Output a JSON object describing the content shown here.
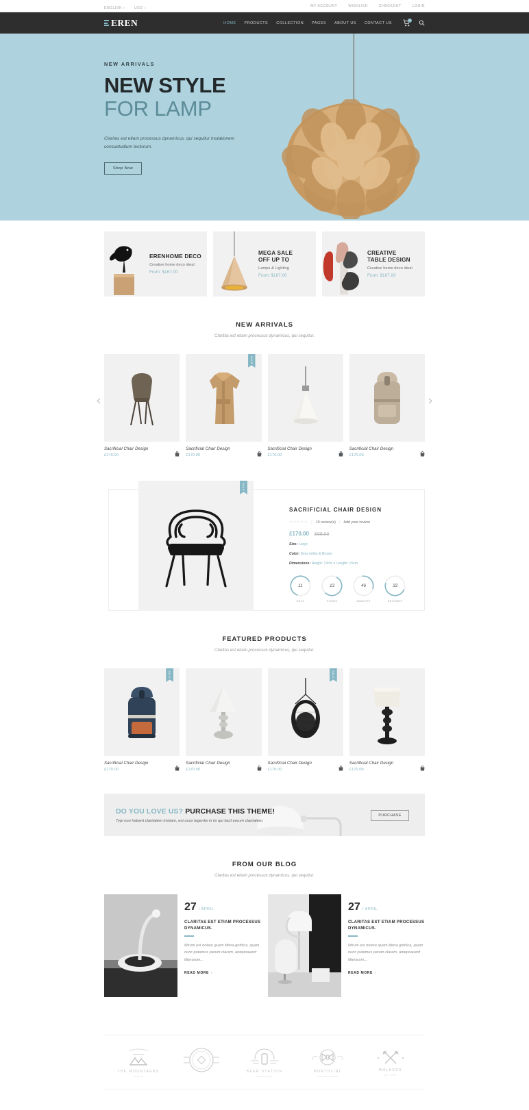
{
  "topbar": {
    "language": "ENGLISH",
    "currency": "USD",
    "links": [
      "MY ACCOUNT",
      "WISHLISH",
      "CHECKOUT",
      "LOGIN"
    ]
  },
  "header": {
    "brand": "EREN",
    "nav": [
      {
        "label": "HOME",
        "active": true
      },
      {
        "label": "PRODUCTS",
        "active": false
      },
      {
        "label": "COLLECTION",
        "active": false
      },
      {
        "label": "PAGES",
        "active": false
      },
      {
        "label": "ABOUT US",
        "active": false
      },
      {
        "label": "CONTACT US",
        "active": false
      }
    ],
    "cart_count": "0",
    "search_icon": "search-icon",
    "cart_icon": "cart-icon"
  },
  "hero": {
    "eyebrow": "NEW ARRIVALS",
    "title_line1": "NEW STYLE",
    "title_line2": "FOR LAMP",
    "paragraph": "Claritas est etiam processus dynamicus, qui sequitur mutationem consuetudium lectorum.",
    "cta": "Shop Now",
    "bg_color": "#aed3de"
  },
  "promos": [
    {
      "title": "ERENHOME DECO",
      "subtitle": "Creative home deco ideal",
      "price": "From: $167.00",
      "art": "bird-statue"
    },
    {
      "title": "MEGA SALE\nOFF UP TO",
      "title_line1": "MEGA SALE",
      "title_line2": "OFF UP TO",
      "subtitle": "Lamps & Lighting",
      "price": "From: $167.00",
      "art": "cone-pendant-lamp"
    },
    {
      "title_line1": "CREATIVE",
      "title_line2": "TABLE DESIGN",
      "subtitle": "Creative home deco ideal",
      "price": "From: $167.00",
      "art": "modern-table"
    }
  ],
  "new_arrivals": {
    "title": "NEW ARRIVALS",
    "subtitle": "Claritas est etiam processus dynamicus, qui sequitur.",
    "prev_icon": "chevron-left-icon",
    "next_icon": "chevron-right-icon",
    "products": [
      {
        "name": "Sacrificial Chair Design",
        "price": "£170.00",
        "badge": "",
        "art": "chair"
      },
      {
        "name": "Sacrificial Chair Design",
        "price": "£170.00",
        "badge": "SALE",
        "art": "jacket"
      },
      {
        "name": "Sacrificial Chair Design",
        "price": "£170.00",
        "badge": "",
        "art": "pendant-light"
      },
      {
        "name": "Sacrificial Chair Design",
        "price": "£170.00",
        "badge": "",
        "art": "backpack"
      }
    ]
  },
  "deal": {
    "badge": "SALE",
    "title": "SACRIFICIAL CHAIR DESIGN",
    "stars": "☆☆☆☆☆",
    "reviews": "10 review(s)",
    "add_review": "Add your review",
    "price_new": "£170.00",
    "price_old": "£69.00",
    "attrs": [
      {
        "label": "Size:",
        "value": "Large"
      },
      {
        "label": "Color:",
        "value": "Grey white & Brown"
      },
      {
        "label": "Dimensions:",
        "value": "Height: 13cm x Length: 15cm"
      }
    ],
    "countdown": [
      {
        "value": "11",
        "label": "DAYS",
        "percent": 62
      },
      {
        "value": "13",
        "label": "HOURS",
        "percent": 54
      },
      {
        "value": "46",
        "label": "MINUTES",
        "percent": 77
      },
      {
        "value": "33",
        "label": "SECONDS",
        "percent": 55
      }
    ],
    "art": "black-wire-chair"
  },
  "featured": {
    "title": "FEATURED PRODUCTS",
    "subtitle": "Claritas est etiam processus dynamicus, qui sequitur.",
    "products": [
      {
        "name": "Sacrificial Chair Design",
        "price": "£170.00",
        "badge": "SALE",
        "art": "backpack-navy"
      },
      {
        "name": "Sacrificial Chair Design",
        "price": "£170.00",
        "badge": "",
        "art": "table-lamp"
      },
      {
        "name": "Sacrificial Chair Design",
        "price": "£170.00",
        "badge": "SALE",
        "art": "hanging-egg-chair"
      },
      {
        "name": "Sacrificial Chair Design",
        "price": "£170.00",
        "badge": "",
        "art": "floor-lamp"
      }
    ]
  },
  "purchase_banner": {
    "heading_accent": "DO YOU LOVE US?",
    "heading_main": "PURCHASE THIS THEME!",
    "paragraph": "Typi non habent claritatem insitam, est usus legentis in iis qui facit eorum claritatem.",
    "button": "PURCHASE",
    "art": "desk-lamp"
  },
  "blog": {
    "title": "FROM OUR BLOG",
    "subtitle": "Claritas est etiam processus dynamicus, qui sequitur.",
    "posts": [
      {
        "day": "27",
        "month": "/ APRIL",
        "title": "CLARITAS EST ETIAM PROCESSUS DYNAMICUS.",
        "excerpt": "Mirum est notare quam littera gothica, quam nunc putamus parum claram, antepoauerit litterarum...",
        "read_more": "READ MORE",
        "art": "white-floor-lamp"
      },
      {
        "day": "27",
        "month": "/ APRIL",
        "title": "CLARITAS EST ETIAM PROCESSUS DYNAMICUS.",
        "excerpt": "Mirum est notare quam littera gothica, quam nunc putamus parum claram, antepoauerit litterarum...",
        "read_more": "READ MORE",
        "art": "interior-lamp-chair"
      }
    ]
  },
  "brands": [
    {
      "name": "THE MOUNTAENS",
      "sub": "DESIGN",
      "mark": "mountain-badge"
    },
    {
      "name": "",
      "sub": "",
      "mark": "vintage-circle-badge"
    },
    {
      "name": "BEER STATION",
      "sub": "RESTAURANT",
      "mark": "beer-glass-badge"
    },
    {
      "name": "BORTOLINI",
      "sub": "THE RESTAURANT",
      "mark": "bowtie-badge"
    },
    {
      "name": "WALKERS",
      "sub": "EST. 1987",
      "mark": "axes-badge"
    }
  ],
  "theme": {
    "accent": "#86b7c4",
    "dark": "#2e2e2e",
    "light_gray": "#f1f1f1"
  }
}
